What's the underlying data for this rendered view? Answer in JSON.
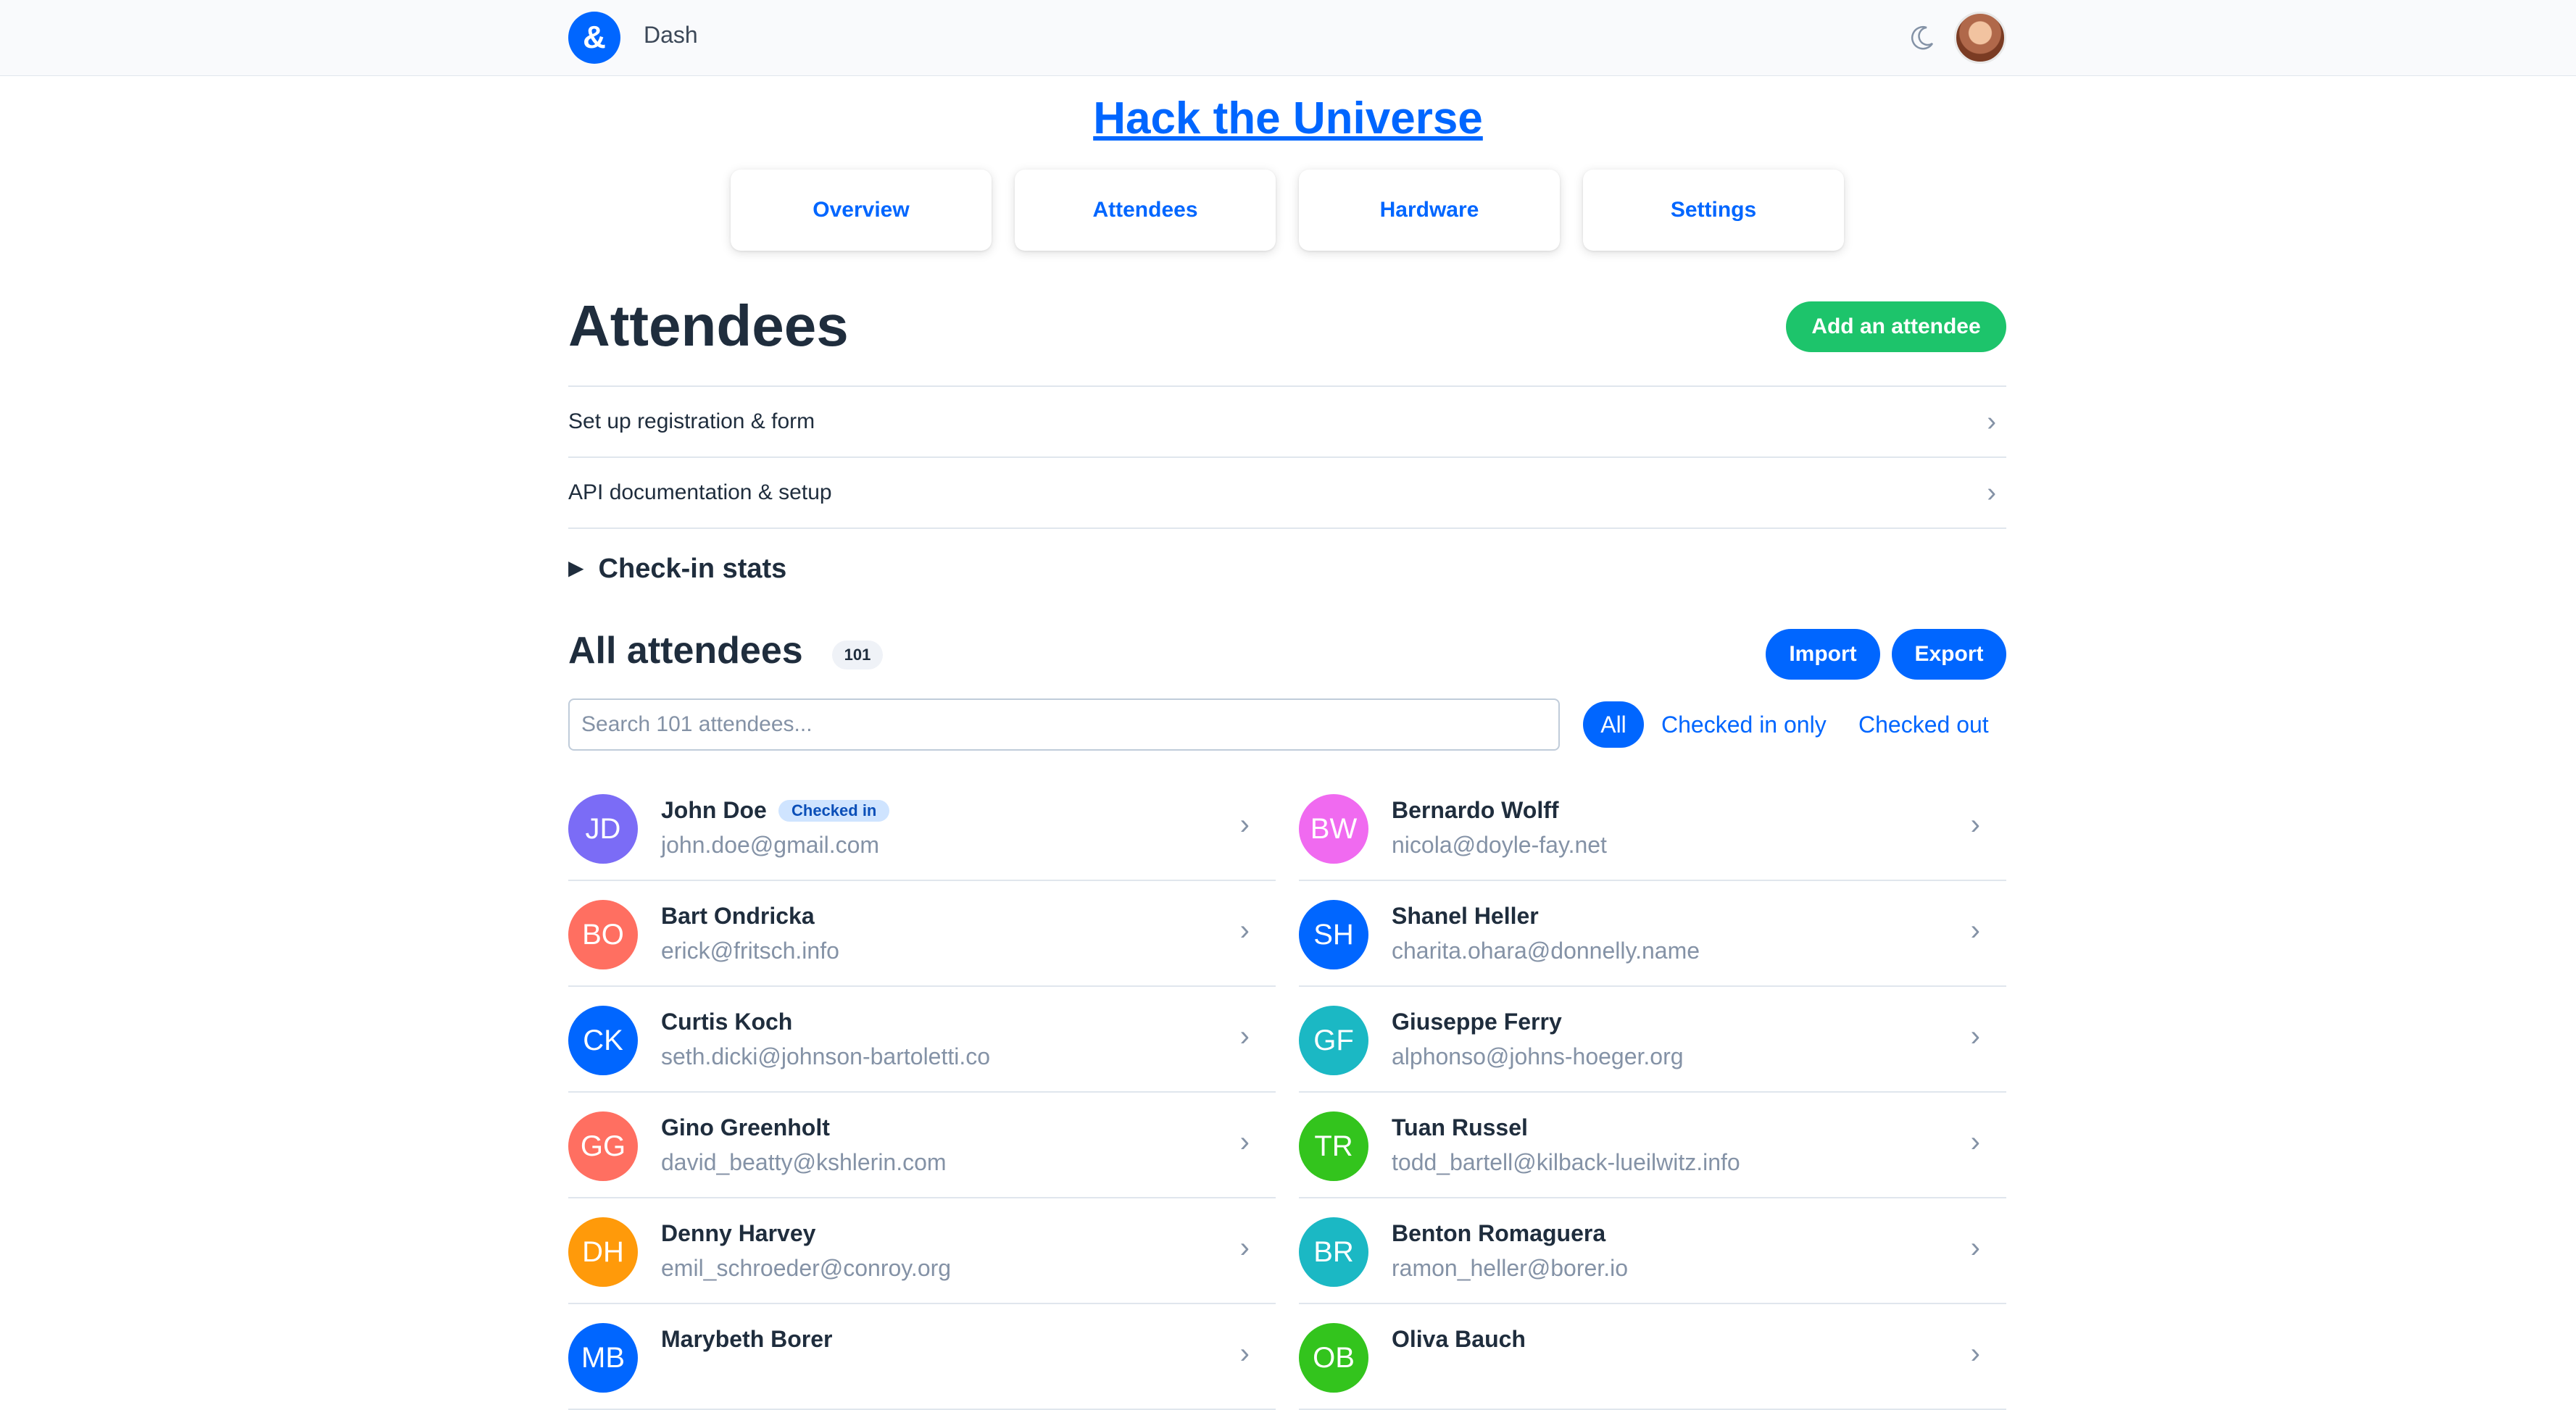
{
  "topbar": {
    "logo_glyph": "&",
    "brand": "Dash",
    "icons": [
      "moon-icon",
      "user-avatar"
    ]
  },
  "event": {
    "title": "Hack the Universe"
  },
  "tabs": [
    {
      "label": "Overview"
    },
    {
      "label": "Attendees"
    },
    {
      "label": "Hardware"
    },
    {
      "label": "Settings"
    }
  ],
  "page": {
    "heading": "Attendees",
    "add_button": "Add an attendee"
  },
  "links": [
    {
      "label": "Set up registration & form"
    },
    {
      "label": "API documentation & setup"
    }
  ],
  "stats": {
    "label": "Check-in stats"
  },
  "list": {
    "heading": "All attendees",
    "count": "101",
    "import_label": "Import",
    "export_label": "Export",
    "search_placeholder": "Search 101 attendees...",
    "filters": [
      "All",
      "Checked in only",
      "Checked out"
    ],
    "active_filter": "All"
  },
  "attendees": [
    {
      "initials": "JD",
      "name": "John Doe",
      "email": "john.doe@gmail.com",
      "badge": "Checked in",
      "color": "#7b6cf6"
    },
    {
      "initials": "BW",
      "name": "Bernardo Wolff",
      "email": "nicola@doyle-fay.net",
      "color": "#f06af0"
    },
    {
      "initials": "BO",
      "name": "Bart Ondricka",
      "email": "erick@fritsch.info",
      "color": "#ff6f61"
    },
    {
      "initials": "SH",
      "name": "Shanel Heller",
      "email": "charita.ohara@donnelly.name",
      "color": "#0066ff"
    },
    {
      "initials": "CK",
      "name": "Curtis Koch",
      "email": "seth.dicki@johnson-bartoletti.co",
      "color": "#0066ff"
    },
    {
      "initials": "GF",
      "name": "Giuseppe Ferry",
      "email": "alphonso@johns-hoeger.org",
      "color": "#1bb8c4"
    },
    {
      "initials": "GG",
      "name": "Gino Greenholt",
      "email": "david_beatty@kshlerin.com",
      "color": "#ff6f61"
    },
    {
      "initials": "TR",
      "name": "Tuan Russel",
      "email": "todd_bartell@kilback-lueilwitz.info",
      "color": "#33c41d"
    },
    {
      "initials": "DH",
      "name": "Denny Harvey",
      "email": "emil_schroeder@conroy.org",
      "color": "#ff9a0a"
    },
    {
      "initials": "BR",
      "name": "Benton Romaguera",
      "email": "ramon_heller@borer.io",
      "color": "#1bb8c4"
    },
    {
      "initials": "MB",
      "name": "Marybeth Borer",
      "email": "",
      "color": "#0066ff"
    },
    {
      "initials": "OB",
      "name": "Oliva Bauch",
      "email": "",
      "color": "#33c41d"
    }
  ],
  "colors": {
    "accent": "#0066ff",
    "success": "#1dc46b",
    "muted": "#8492a6",
    "border": "#e0e6ed"
  }
}
